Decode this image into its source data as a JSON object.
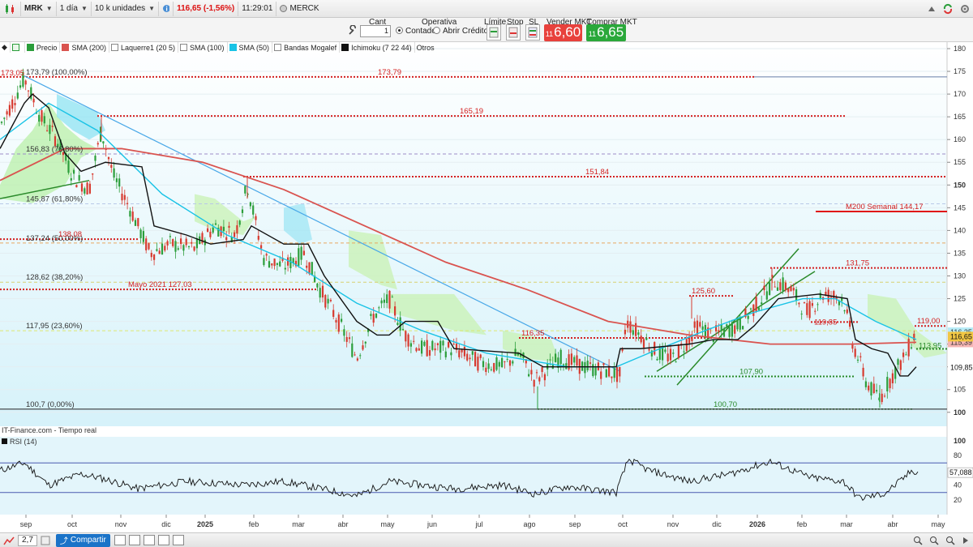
{
  "topbar": {
    "symbol": "MRK",
    "timeframe": "1 día",
    "units": "10 k unidades",
    "price_change": "116,65 (-1,56%)",
    "time": "11:29:01",
    "name": "MERCK"
  },
  "order_panel": {
    "cant_label": "Cant",
    "cant_value": "1",
    "operativa_label": "Operativa",
    "contado_label": "Contado",
    "abrir_credito_label": "Abrir Crédito",
    "limite_label": "Límite",
    "stop_label": "Stop",
    "sl_label": "SL",
    "vender_label": "Vender MKT",
    "comprar_label": "Comprar MKT",
    "vender_small": "11",
    "vender_big": "6,60",
    "comprar_small": "11",
    "comprar_big": "6,65",
    "vender_color": "#e8413c",
    "comprar_color": "#2aa83a"
  },
  "legend": {
    "precio": "Precio",
    "sma200": "SMA (200)",
    "laquerre": "Laquerre1 (20 5)",
    "sma100": "SMA (100)",
    "sma50": "SMA (50)",
    "bandas": "Bandas Mogalef",
    "ichimoku": "Ichimoku (7 22 44)",
    "otros": "Otros"
  },
  "panel": {
    "source": "IT-Finance.com - Tiempo real",
    "rsi_label": "RSI (14)"
  },
  "price_axis": {
    "ticks": [
      "180",
      "175",
      "170",
      "165",
      "160",
      "155",
      "150",
      "145",
      "140",
      "135",
      "130",
      "125",
      "120",
      "115",
      "110",
      "105",
      "100"
    ]
  },
  "rsi_axis": {
    "ticks": [
      "100",
      "80",
      "60",
      "40",
      "20"
    ],
    "current": "57,088"
  },
  "time_axis": {
    "labels": [
      "sep",
      "oct",
      "nov",
      "dic",
      "2025",
      "feb",
      "mar",
      "abr",
      "may",
      "jun",
      "jul",
      "ago",
      "sep",
      "oct",
      "nov",
      "dic",
      "2026",
      "feb",
      "mar",
      "abr",
      "may"
    ]
  },
  "fibonacci": [
    {
      "label": "173,79 (100,00%)",
      "value": 173.79
    },
    {
      "label": "156,83 (76,80%)",
      "value": 156.83
    },
    {
      "label": "145,87 (61,80%)",
      "value": 145.87
    },
    {
      "label": "137,24 (50,00%)",
      "value": 137.24
    },
    {
      "label": "128,62 (38,20%)",
      "value": 128.62
    },
    {
      "label": "117,95 (23,60%)",
      "value": 117.95
    },
    {
      "label": "100,7 (0,00%)",
      "value": 100.7
    }
  ],
  "annotations": {
    "a173_05": "173,05",
    "a173_79": "173,79",
    "a165_19": "165,19",
    "a151_84": "151,84",
    "a138_08": "138,08",
    "mayo2021": "Mayo 2021 127,03",
    "m200": "M200 Semanal 144,17",
    "a131_75": "131,75",
    "a125_60": "125,60",
    "a119_85": "119,85",
    "a119_00": "119,00",
    "a116_35": "116,35",
    "a113_95": "113,95",
    "a107_90": "107,90",
    "a100_70": "100,70"
  },
  "right_markers": {
    "last_price": "116,65",
    "sma200_value": "115,39",
    "sma50_value": "116,35",
    "ichimoku_value": "109,85"
  },
  "bottombar": {
    "zoom": "2,7",
    "share": "Compartir"
  },
  "chart_data": {
    "type": "candlestick",
    "price_range": [
      97,
      181
    ],
    "rsi_range": [
      0,
      100
    ],
    "anchors": [
      [
        0,
        163
      ],
      [
        12,
        167
      ],
      [
        30,
        173.5
      ],
      [
        50,
        165
      ],
      [
        70,
        160
      ],
      [
        90,
        152
      ],
      [
        110,
        149
      ],
      [
        125,
        162
      ],
      [
        140,
        152
      ],
      [
        160,
        145
      ],
      [
        185,
        135
      ],
      [
        210,
        137
      ],
      [
        240,
        136
      ],
      [
        265,
        141
      ],
      [
        290,
        139
      ],
      [
        305,
        150
      ],
      [
        325,
        134
      ],
      [
        350,
        132
      ],
      [
        375,
        135
      ],
      [
        395,
        127
      ],
      [
        420,
        119
      ],
      [
        440,
        112
      ],
      [
        460,
        121
      ],
      [
        480,
        125
      ],
      [
        500,
        117
      ],
      [
        520,
        114
      ],
      [
        560,
        114
      ],
      [
        590,
        111
      ],
      [
        620,
        110
      ],
      [
        640,
        113
      ],
      [
        660,
        107
      ],
      [
        690,
        112
      ],
      [
        720,
        110
      ],
      [
        750,
        109
      ],
      [
        765,
        108
      ],
      [
        772,
        120
      ],
      [
        790,
        117
      ],
      [
        810,
        113
      ],
      [
        830,
        112
      ],
      [
        845,
        115
      ],
      [
        860,
        119
      ],
      [
        880,
        117
      ],
      [
        910,
        119
      ],
      [
        935,
        124
      ],
      [
        955,
        129
      ],
      [
        975,
        127
      ],
      [
        995,
        122
      ],
      [
        1015,
        126
      ],
      [
        1040,
        125
      ],
      [
        1052,
        115
      ],
      [
        1070,
        106
      ],
      [
        1085,
        103
      ],
      [
        1100,
        108
      ],
      [
        1115,
        112
      ],
      [
        1128,
        117
      ]
    ],
    "sma200": [
      [
        0,
        151
      ],
      [
        80,
        158
      ],
      [
        150,
        158
      ],
      [
        250,
        155
      ],
      [
        350,
        149
      ],
      [
        450,
        141
      ],
      [
        550,
        133
      ],
      [
        650,
        127
      ],
      [
        750,
        120
      ],
      [
        850,
        117
      ],
      [
        950,
        115
      ],
      [
        1050,
        115
      ],
      [
        1130,
        115.4
      ]
    ],
    "sma50": [
      [
        0,
        160
      ],
      [
        60,
        168
      ],
      [
        120,
        162
      ],
      [
        200,
        148
      ],
      [
        280,
        139
      ],
      [
        360,
        133
      ],
      [
        440,
        124
      ],
      [
        520,
        118
      ],
      [
        600,
        113
      ],
      [
        700,
        110
      ],
      [
        760,
        110
      ],
      [
        800,
        113
      ],
      [
        870,
        118
      ],
      [
        930,
        122
      ],
      [
        990,
        125
      ],
      [
        1030,
        125
      ],
      [
        1080,
        120
      ],
      [
        1130,
        116
      ]
    ],
    "ichimoku": [
      [
        0,
        158
      ],
      [
        30,
        168
      ],
      [
        40,
        170
      ],
      [
        60,
        167
      ],
      [
        80,
        157
      ],
      [
        100,
        153
      ],
      [
        130,
        155
      ],
      [
        175,
        154
      ],
      [
        190,
        141
      ],
      [
        230,
        139
      ],
      [
        260,
        137
      ],
      [
        300,
        138
      ],
      [
        310,
        141
      ],
      [
        350,
        137
      ],
      [
        380,
        137
      ],
      [
        400,
        130
      ],
      [
        440,
        120
      ],
      [
        465,
        117
      ],
      [
        480,
        117
      ],
      [
        500,
        120
      ],
      [
        540,
        120
      ],
      [
        560,
        114
      ],
      [
        640,
        113
      ],
      [
        670,
        110
      ],
      [
        760,
        110
      ],
      [
        765,
        114
      ],
      [
        790,
        114
      ],
      [
        850,
        115
      ],
      [
        880,
        116
      ],
      [
        910,
        116
      ],
      [
        930,
        119
      ],
      [
        960,
        125
      ],
      [
        1010,
        126
      ],
      [
        1045,
        125
      ],
      [
        1055,
        116
      ],
      [
        1075,
        114
      ],
      [
        1095,
        113
      ],
      [
        1110,
        108
      ],
      [
        1120,
        108
      ],
      [
        1130,
        110
      ]
    ],
    "rsi": [
      [
        0,
        60
      ],
      [
        30,
        70
      ],
      [
        60,
        40
      ],
      [
        100,
        55
      ],
      [
        130,
        48
      ],
      [
        170,
        35
      ],
      [
        230,
        45
      ],
      [
        300,
        40
      ],
      [
        350,
        45
      ],
      [
        410,
        32
      ],
      [
        440,
        25
      ],
      [
        480,
        45
      ],
      [
        520,
        40
      ],
      [
        560,
        35
      ],
      [
        620,
        40
      ],
      [
        660,
        28
      ],
      [
        700,
        38
      ],
      [
        760,
        30
      ],
      [
        775,
        75
      ],
      [
        800,
        60
      ],
      [
        850,
        45
      ],
      [
        900,
        55
      ],
      [
        950,
        72
      ],
      [
        1000,
        50
      ],
      [
        1040,
        45
      ],
      [
        1060,
        22
      ],
      [
        1090,
        28
      ],
      [
        1110,
        45
      ],
      [
        1125,
        60
      ],
      [
        1132,
        57
      ]
    ],
    "levels": {
      "fib_100": 173.79,
      "fib_768": 156.83,
      "fib_618": 145.87,
      "fib_500": 137.24,
      "fib_382": 128.62,
      "fib_236": 117.95,
      "fib_0": 100.7,
      "res_173": 173.79,
      "res_165": 165.19,
      "res_151": 151.84,
      "res_138": 138.08,
      "mayo2021": 127.03,
      "m200w": 144.17,
      "r131": 131.75,
      "r125": 125.6,
      "r119_85": 119.85,
      "r119": 119.0,
      "s116": 116.35,
      "s113": 113.95,
      "s107": 107.9,
      "s100": 100.7
    }
  }
}
